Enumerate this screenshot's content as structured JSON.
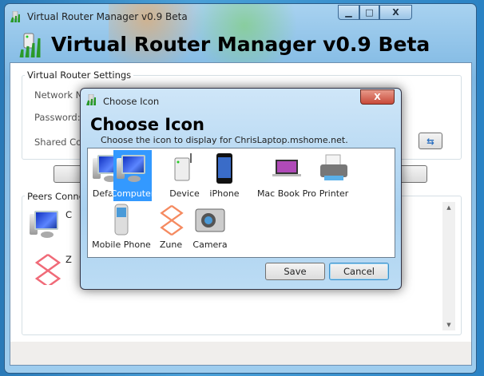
{
  "main_window": {
    "title": "Virtual Router Manager v0.9 Beta",
    "heading": "Virtual Router Manager v0.9 Beta",
    "controls": {
      "minimize": "▁",
      "maximize": "□",
      "close": "X"
    },
    "settings_group": {
      "label": "Virtual Router Settings",
      "network_name_label": "Network N",
      "password_label": "Password:",
      "shared_connection_label": "Shared Co",
      "refresh_icon": "⇆"
    },
    "peers_group": {
      "label": "Peers Conne",
      "peers": [
        {
          "icon": "computer-icon",
          "name": "C"
        },
        {
          "icon": "zune-icon",
          "name": "Z"
        }
      ]
    },
    "scroll": {
      "up": "▲",
      "down": "▼"
    }
  },
  "dialog": {
    "title": "Choose Icon",
    "close": "X",
    "heading": "Choose Icon",
    "subtitle": "Choose the icon to display for ChrisLaptop.mshome.net.",
    "icons": [
      {
        "label": "Default",
        "type": "computer"
      },
      {
        "label": "Computer",
        "type": "computer",
        "selected": true
      },
      {
        "label": "Device",
        "type": "device"
      },
      {
        "label": "iPhone",
        "type": "iphone"
      },
      {
        "label": "Mac Book Pro",
        "type": "laptop"
      },
      {
        "label": "Printer",
        "type": "printer"
      },
      {
        "label": "Mobile Phone",
        "type": "phone"
      },
      {
        "label": "Zune",
        "type": "zune"
      },
      {
        "label": "Camera",
        "type": "camera"
      }
    ],
    "save": "Save",
    "cancel": "Cancel"
  },
  "colors": {
    "selection": "#3399ff",
    "close_red": "#c84a3a"
  }
}
